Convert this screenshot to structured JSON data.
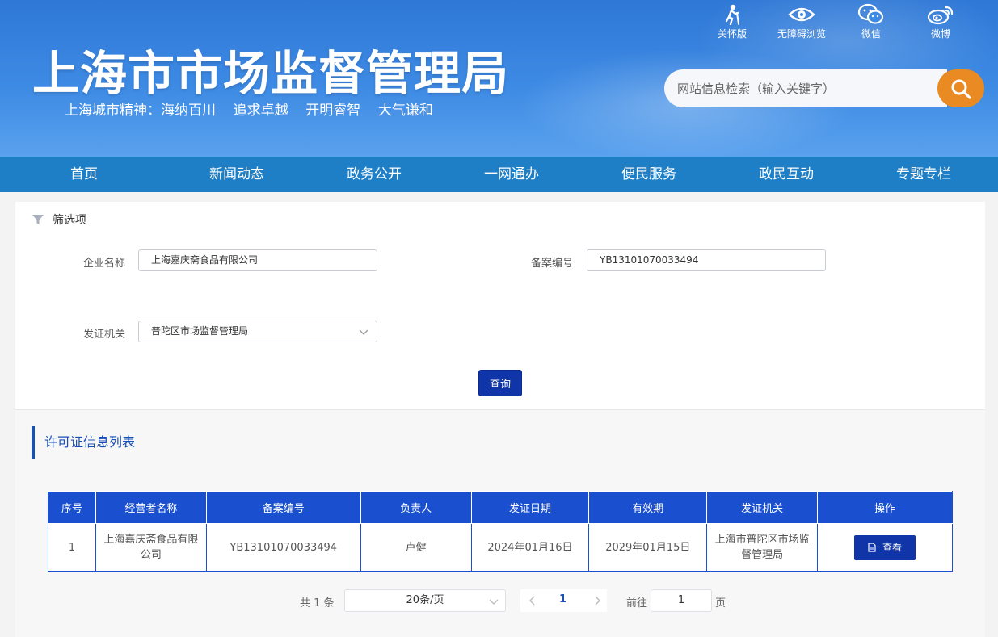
{
  "header": {
    "title": "上海市市场监督管理局",
    "slogan": "上海城市精神：海纳百川    追求卓越    开明睿智    大气谦和",
    "tools": [
      {
        "label": "关怀版",
        "icon": "elder-care-icon"
      },
      {
        "label": "无障碍浏览",
        "icon": "eye-icon"
      },
      {
        "label": "微信",
        "icon": "wechat-icon"
      },
      {
        "label": "微博",
        "icon": "weibo-icon"
      }
    ],
    "search": {
      "placeholder": "网站信息检索（输入关键字）"
    }
  },
  "nav": {
    "items": [
      "首页",
      "新闻动态",
      "政务公开",
      "一网通办",
      "便民服务",
      "政民互动",
      "专题专栏"
    ]
  },
  "filter": {
    "title": "筛选项",
    "company_label": "企业名称",
    "company_value": "上海嘉庆斋食品有限公司",
    "record_label": "备案编号",
    "record_value": "YB13101070033494",
    "authority_label": "发证机关",
    "authority_value": "普陀区市场监督管理局",
    "query_label": "查询"
  },
  "list": {
    "title": "许可证信息列表",
    "columns": [
      "序号",
      "经营者名称",
      "备案编号",
      "负责人",
      "发证日期",
      "有效期",
      "发证机关",
      "操作"
    ],
    "rows": [
      {
        "index": "1",
        "name": "上海嘉庆斋食品有限公司",
        "record": "YB13101070033494",
        "owner": "卢健",
        "issue_date": "2024年01月16日",
        "valid_until": "2029年01月15日",
        "authority": "上海市普陀区市场监督管理局",
        "action": "查看"
      }
    ]
  },
  "pager": {
    "total": "共 1 条",
    "page_size": "20条/页",
    "current": "1",
    "goto_label": "前往",
    "goto_value": "1",
    "page_unit": "页"
  },
  "colors": {
    "header_blue": "#2f78d6",
    "nav_blue": "#1e7fc6",
    "table_head": "#1a4fd0",
    "button_dark_blue": "#1035a8",
    "search_orange": "#e98a22"
  }
}
